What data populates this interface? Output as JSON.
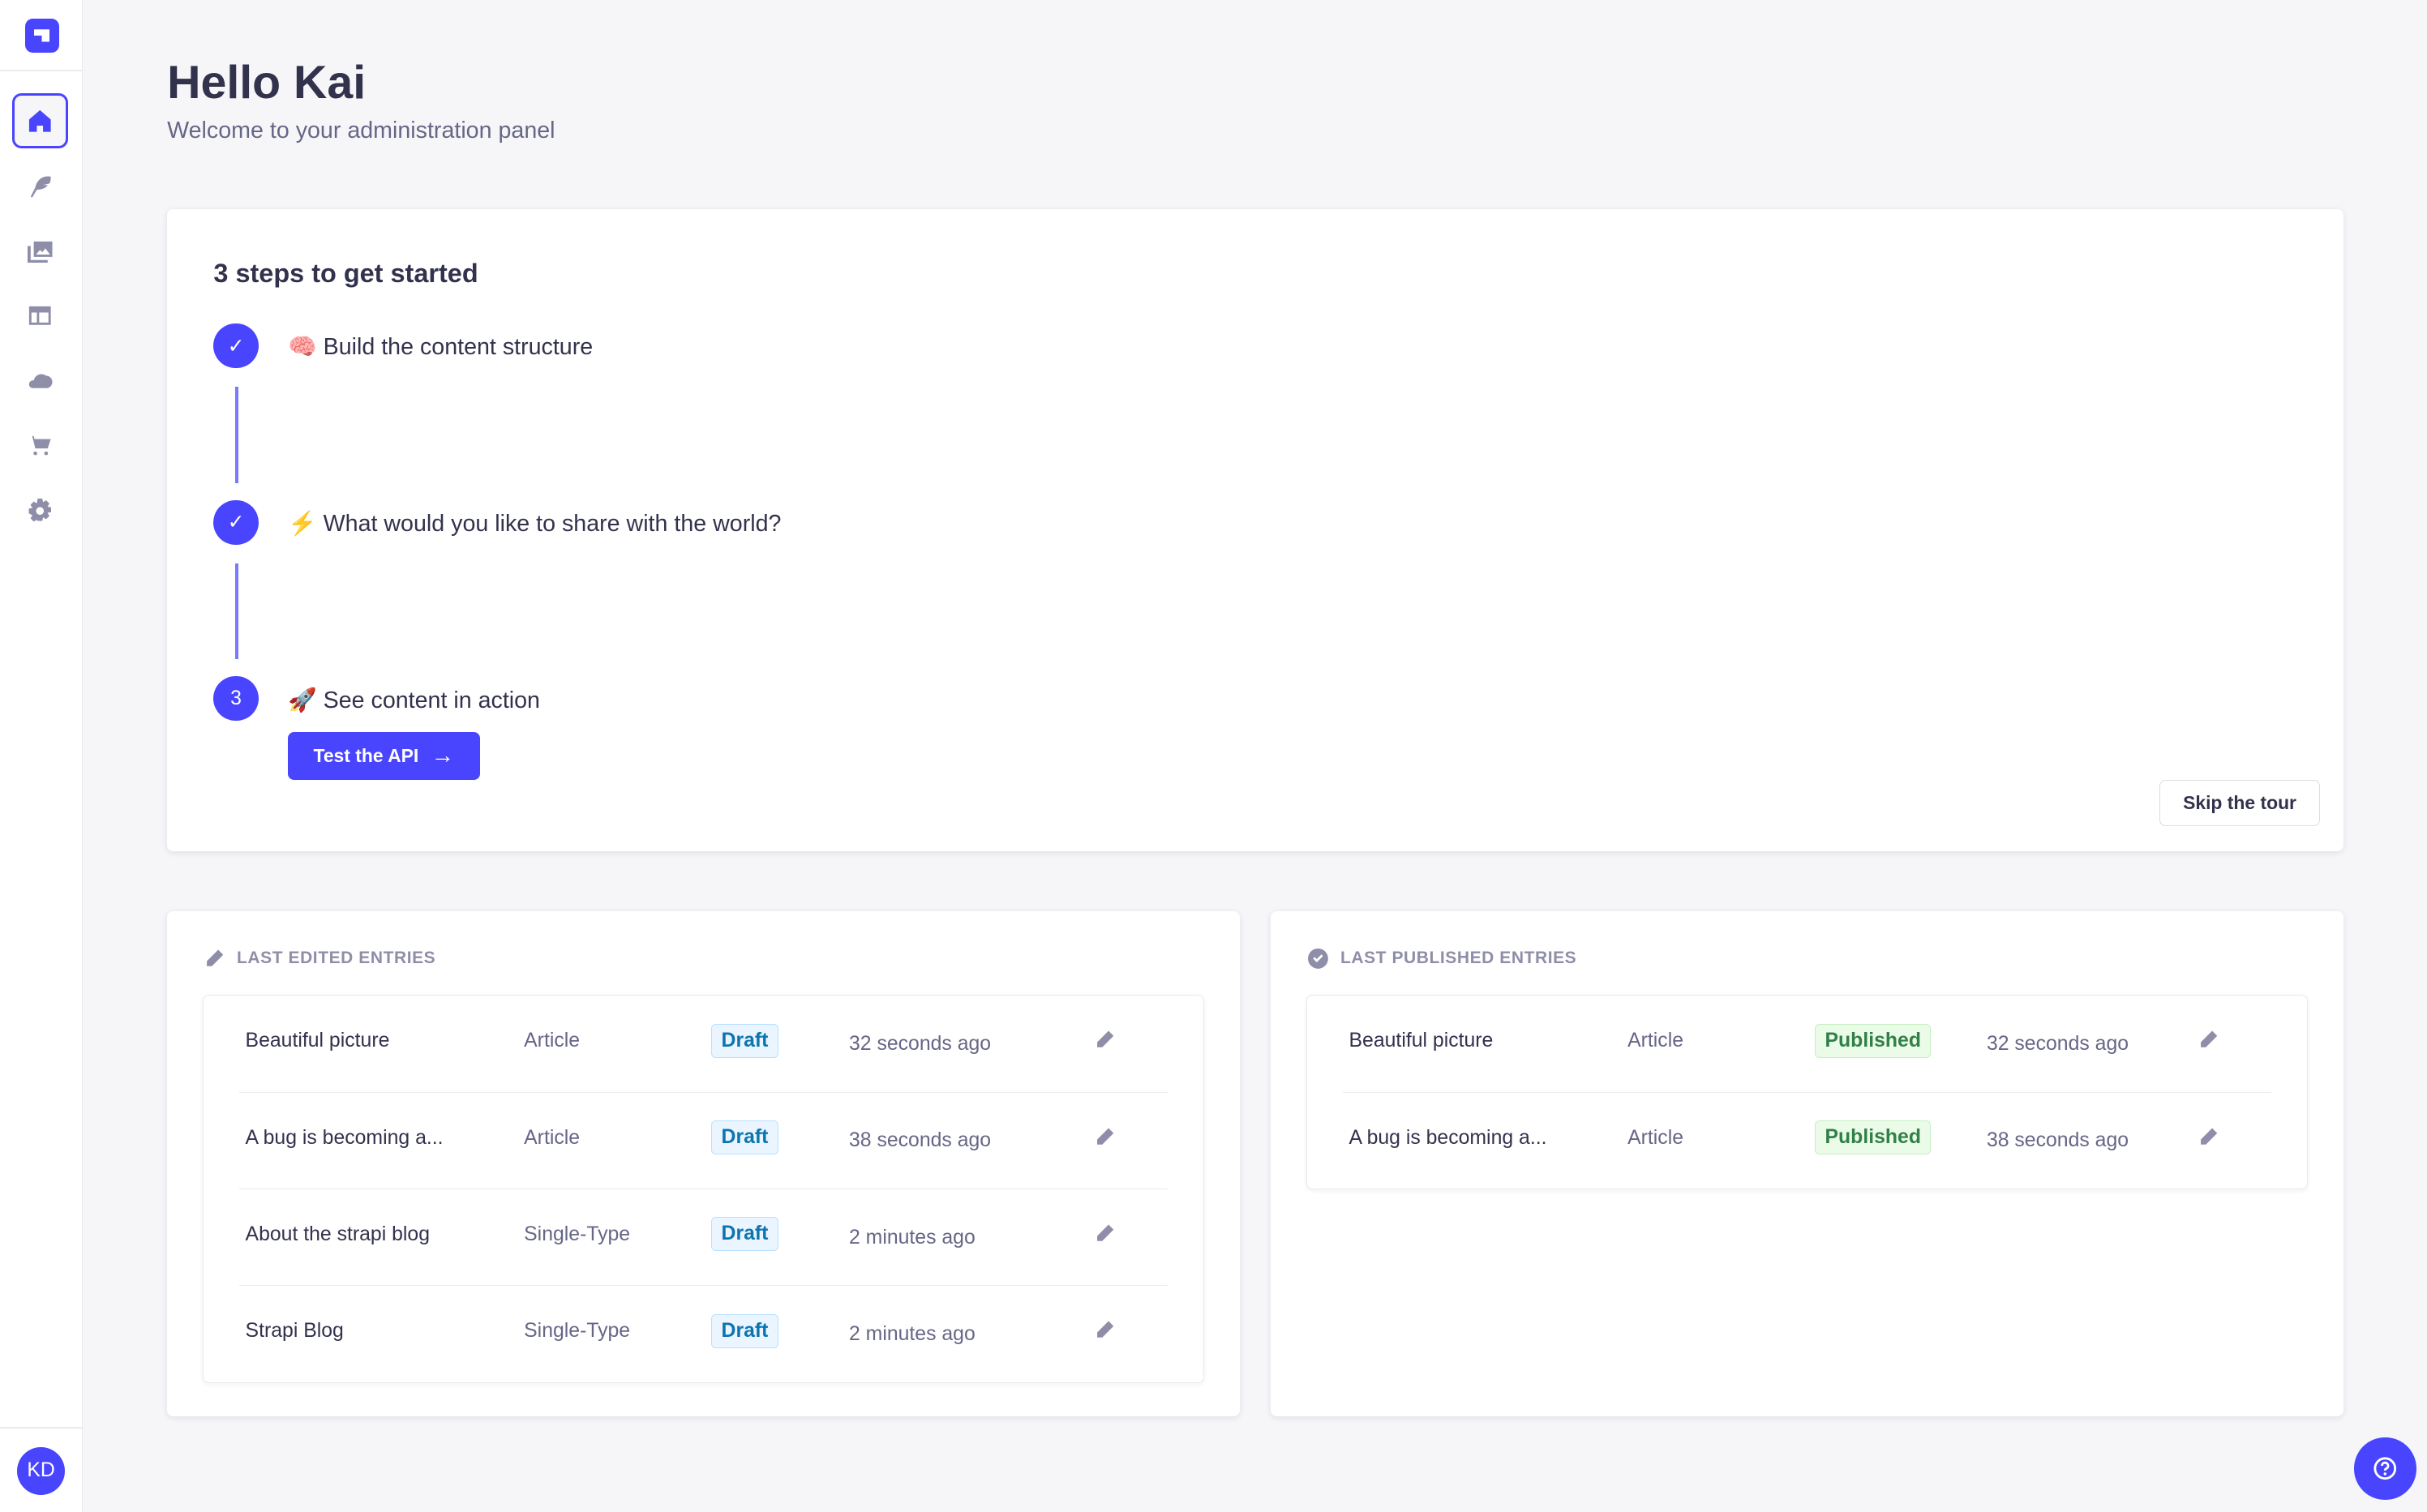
{
  "sidebar": {
    "items": [
      {
        "id": "home",
        "icon": "home-icon",
        "active": true
      },
      {
        "id": "content-manager",
        "icon": "feather-icon"
      },
      {
        "id": "media-library",
        "icon": "images-icon"
      },
      {
        "id": "content-type-builder",
        "icon": "layout-icon"
      },
      {
        "id": "cloud",
        "icon": "cloud-icon"
      },
      {
        "id": "marketplace",
        "icon": "cart-icon"
      },
      {
        "id": "settings",
        "icon": "gear-icon"
      }
    ],
    "user_initials": "KD",
    "accent": "#4945ff"
  },
  "header": {
    "title": "Hello Kai",
    "subtitle": "Welcome to your administration panel"
  },
  "onboarding": {
    "title": "3 steps to get started",
    "steps": [
      {
        "emoji": "🧠",
        "label": "Build the content structure",
        "status": "done"
      },
      {
        "emoji": "⚡",
        "label": "What would you like to share with the world?",
        "status": "done"
      },
      {
        "emoji": "🚀",
        "label": "See content in action",
        "status": "current",
        "number": "3"
      }
    ],
    "test_api_label": "Test the API",
    "skip_label": "Skip the tour"
  },
  "last_edited": {
    "title": "LAST EDITED ENTRIES",
    "rows": [
      {
        "title": "Beautiful picture",
        "type": "Article",
        "status": "Draft",
        "time": "32 seconds ago"
      },
      {
        "title": "A bug is becoming a...",
        "type": "Article",
        "status": "Draft",
        "time": "38 seconds ago"
      },
      {
        "title": "About the strapi blog",
        "type": "Single-Type",
        "status": "Draft",
        "time": "2 minutes ago"
      },
      {
        "title": "Strapi Blog",
        "type": "Single-Type",
        "status": "Draft",
        "time": "2 minutes ago"
      }
    ]
  },
  "last_published": {
    "title": "LAST PUBLISHED ENTRIES",
    "rows": [
      {
        "title": "Beautiful picture",
        "type": "Article",
        "status": "Published",
        "time": "32 seconds ago"
      },
      {
        "title": "A bug is becoming a...",
        "type": "Article",
        "status": "Published",
        "time": "38 seconds ago"
      }
    ]
  }
}
